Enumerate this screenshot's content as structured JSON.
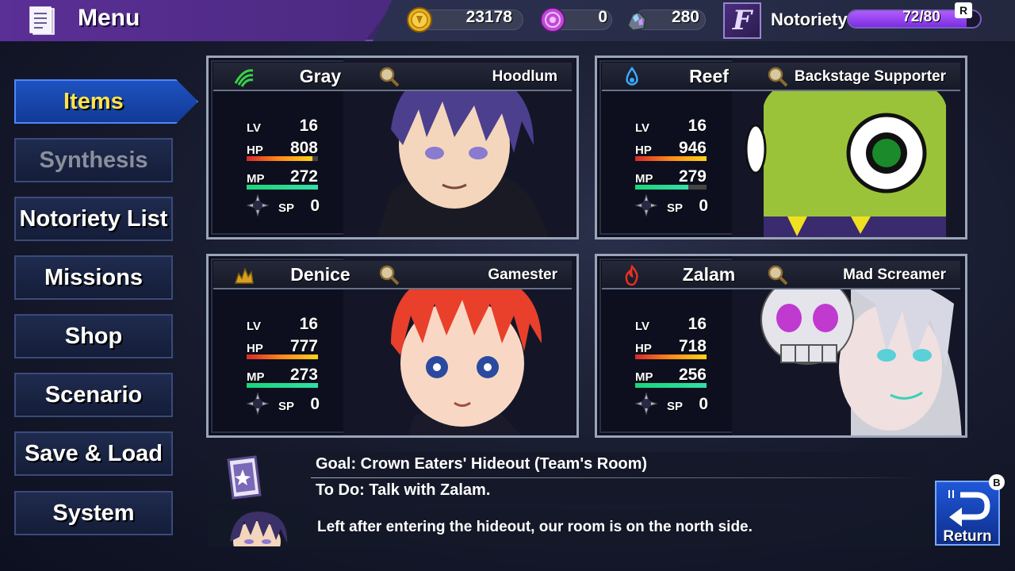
{
  "header": {
    "title": "Menu",
    "currencies": [
      {
        "icon": "gold-coin-icon",
        "value": "23178"
      },
      {
        "icon": "purple-token-icon",
        "value": "0"
      },
      {
        "icon": "crystal-ore-icon",
        "value": "280"
      }
    ],
    "notoriety": {
      "badge_letter": "F",
      "label": "Notoriety",
      "value": "72/80",
      "fraction": 0.9,
      "shortcut": "R"
    }
  },
  "sidebar": {
    "items": [
      {
        "label": "Items",
        "state": "active"
      },
      {
        "label": "Synthesis",
        "state": "disabled"
      },
      {
        "label": "Notoriety List",
        "state": "normal"
      },
      {
        "label": "Missions",
        "state": "normal"
      },
      {
        "label": "Shop",
        "state": "normal"
      },
      {
        "label": "Scenario",
        "state": "normal"
      },
      {
        "label": "Save & Load",
        "state": "normal"
      },
      {
        "label": "System",
        "state": "normal"
      }
    ]
  },
  "party": [
    {
      "name": "Gray",
      "title": "Hoodlum",
      "element_icon": "wind-icon",
      "lv_label": "LV",
      "lv": "16",
      "hp_label": "HP",
      "hp": "808",
      "hp_fraction": 0.92,
      "mp_label": "MP",
      "mp": "272",
      "mp_fraction": 1.0,
      "sp_label": "SP",
      "sp": "0"
    },
    {
      "name": "Reef",
      "title": "Backstage Supporter",
      "element_icon": "water-drop-icon",
      "lv_label": "LV",
      "lv": "16",
      "hp_label": "HP",
      "hp": "946",
      "hp_fraction": 1.0,
      "mp_label": "MP",
      "mp": "279",
      "mp_fraction": 0.74,
      "sp_label": "SP",
      "sp": "0"
    },
    {
      "name": "Denice",
      "title": "Gamester",
      "element_icon": "earth-crystal-icon",
      "lv_label": "LV",
      "lv": "16",
      "hp_label": "HP",
      "hp": "777",
      "hp_fraction": 1.0,
      "mp_label": "MP",
      "mp": "273",
      "mp_fraction": 1.0,
      "sp_label": "SP",
      "sp": "0"
    },
    {
      "name": "Zalam",
      "title": "Mad Screamer",
      "element_icon": "fire-icon",
      "lv_label": "LV",
      "lv": "16",
      "hp_label": "HP",
      "hp": "718",
      "hp_fraction": 1.0,
      "mp_label": "MP",
      "mp": "256",
      "mp_fraction": 1.0,
      "sp_label": "SP",
      "sp": "0"
    }
  ],
  "objective": {
    "goal": "Goal: Crown Eaters' Hideout (Team's Room)",
    "todo": "To Do: Talk with Zalam.",
    "hint": "Left after entering the hideout, our room is on the north side."
  },
  "return_button": {
    "label": "Return",
    "shortcut": "B"
  }
}
